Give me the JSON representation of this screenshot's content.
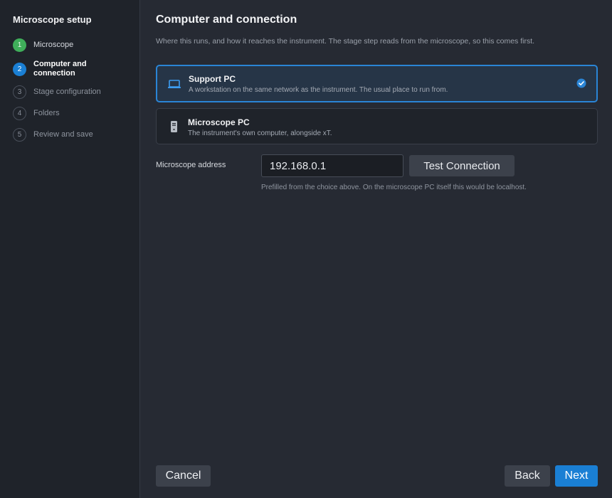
{
  "sidebar": {
    "title": "Microscope setup",
    "steps": [
      {
        "num": "1",
        "label": "Microscope"
      },
      {
        "num": "2",
        "label": "Computer and connection"
      },
      {
        "num": "3",
        "label": "Stage configuration"
      },
      {
        "num": "4",
        "label": "Folders"
      },
      {
        "num": "5",
        "label": "Review and save"
      }
    ]
  },
  "main": {
    "title": "Computer and connection",
    "description": "Where this runs, and how it reaches the instrument. The stage step reads from the microscope, so this comes first.",
    "options": [
      {
        "title": "Support PC",
        "subtitle": "A workstation on the same network as the instrument. The usual place to run from.",
        "icon": "laptop-icon",
        "selected": true
      },
      {
        "title": "Microscope PC",
        "subtitle": "The instrument's own computer, alongside xT.",
        "icon": "tower-pc-icon",
        "selected": false
      }
    ],
    "address": {
      "label": "Microscope address",
      "value": "192.168.0.1",
      "test_label": "Test Connection",
      "hint": "Prefilled from the choice above. On the microscope PC itself this would be localhost."
    }
  },
  "footer": {
    "cancel_label": "Cancel",
    "back_label": "Back",
    "next_label": "Next"
  },
  "colors": {
    "accent": "#1a7fd4",
    "done": "#3fae5a",
    "background": "#262a33",
    "sidebar": "#1f232a"
  }
}
